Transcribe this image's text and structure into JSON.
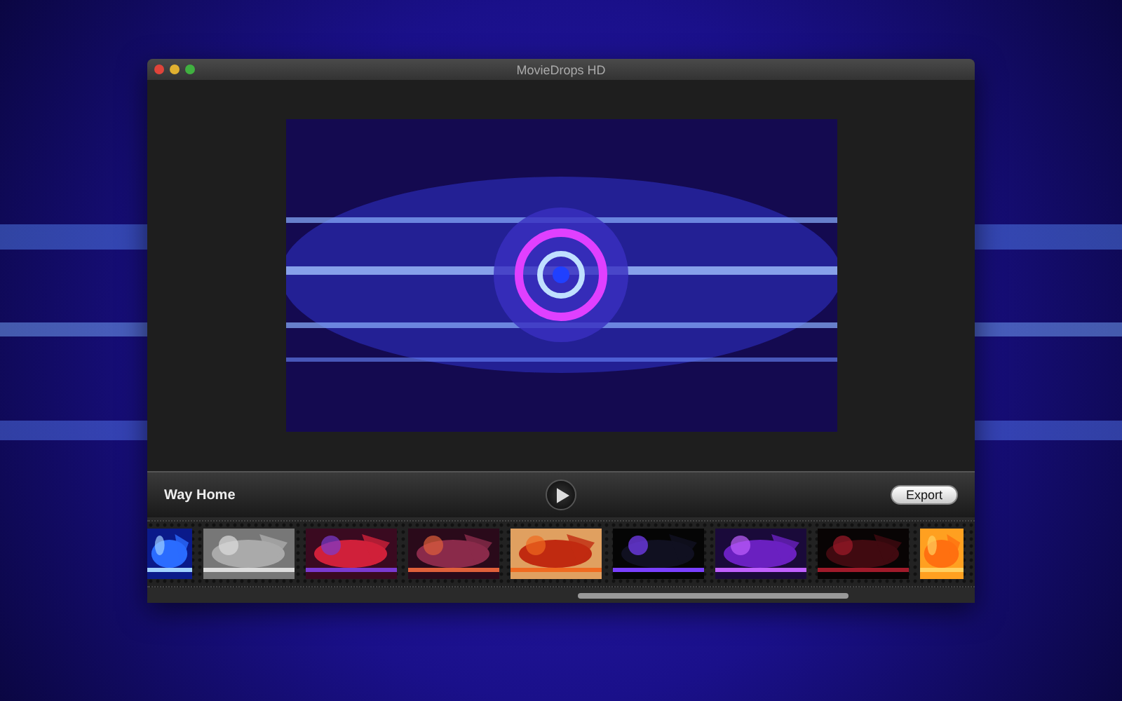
{
  "window": {
    "title": "MovieDrops HD"
  },
  "clip_title": "Way Home",
  "export_button": "Export"
}
